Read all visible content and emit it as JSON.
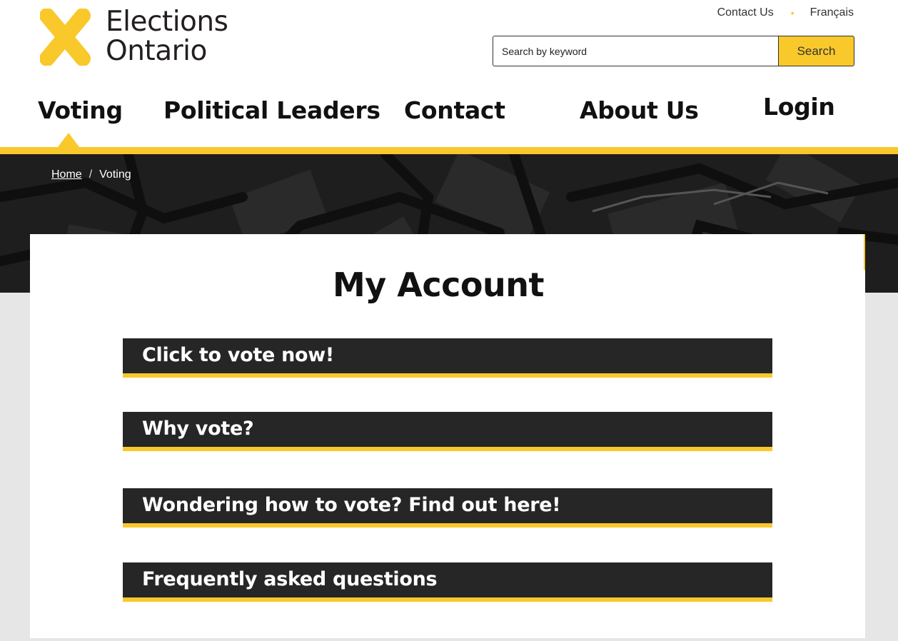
{
  "brand": {
    "name_line1": "Elections",
    "name_line2": "Ontario",
    "logo_color": "#f9c82b"
  },
  "utility": {
    "contact": "Contact Us",
    "separator": "•",
    "language": "Français"
  },
  "search": {
    "placeholder": "Search by keyword",
    "button_label": "Search"
  },
  "nav": {
    "items": [
      {
        "label": "Voting",
        "active": true
      },
      {
        "label": "Political Leaders"
      },
      {
        "label": "Contact"
      },
      {
        "label": "About Us"
      },
      {
        "label": "Login"
      }
    ]
  },
  "breadcrumb": {
    "home": "Home",
    "separator": "/",
    "current": "Voting"
  },
  "main": {
    "title": "My Account",
    "sections": [
      {
        "label": "Click to vote now!"
      },
      {
        "label": "Why vote?"
      },
      {
        "label": "Wondering how to vote? Find out here!"
      },
      {
        "label": "Frequently asked questions"
      }
    ]
  },
  "colors": {
    "accent": "#f9c82b",
    "dark": "#262626",
    "page_bg": "#e6e6e6"
  }
}
